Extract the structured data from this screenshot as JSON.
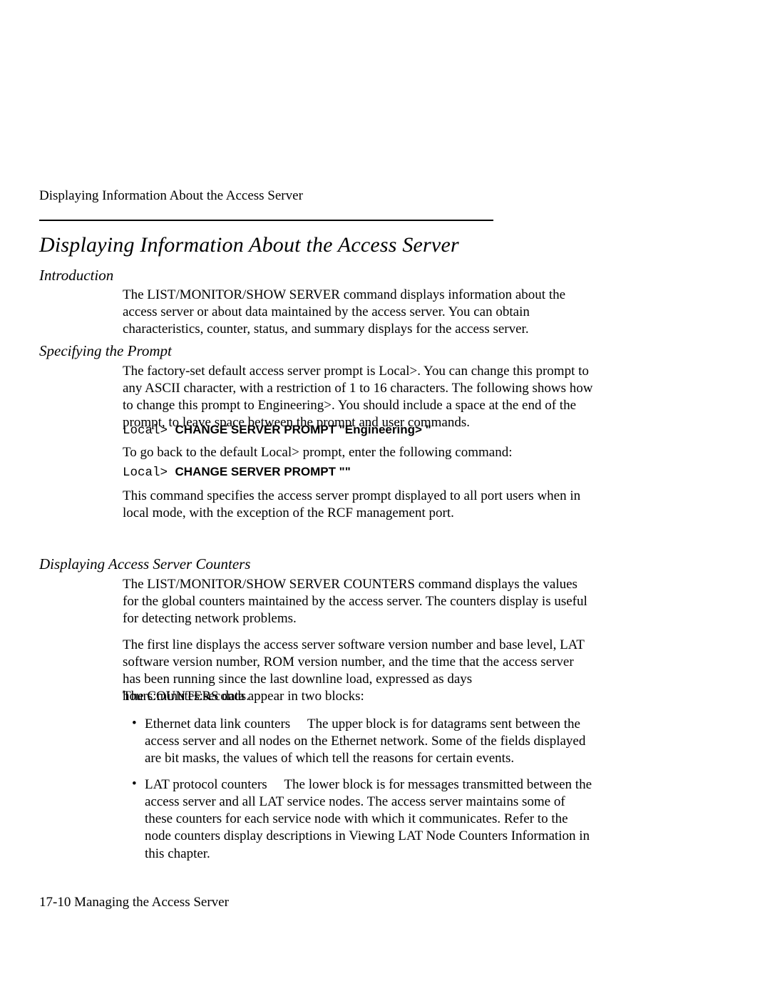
{
  "running_head": "Displaying Information About the Access Server",
  "section_title": "Displaying Information About the Access Server",
  "sections": {
    "intro": {
      "heading": "Introduction",
      "p1": "The LIST/MONITOR/SHOW SERVER command displays information about the access server or about data maintained by the access server. You can obtain characteristics, counter, status, and summary displays for the access server."
    },
    "specifying": {
      "heading": "Specifying the Prompt",
      "p1": "The factory-set default access server prompt is Local>. You can change this prompt to any ASCII character, with a restriction of 1 to 16 characters. The following shows how to change this prompt to Engineering>. You should include a space at the end of the prompt, to leave space between the prompt and user commands.",
      "code1_prefix": "Local> ",
      "code1_cmd": "CHANGE SERVER PROMPT \"Engineering> \"",
      "p2": "To go back to the default Local> prompt, enter the following command:",
      "code2_prefix": "Local> ",
      "code2_cmd": "CHANGE SERVER PROMPT \"\"",
      "p3": "This command specifies the access server prompt displayed to all port users when in local mode, with the exception of the RCF management port."
    },
    "counters": {
      "heading": "Displaying Access Server Counters",
      "p1": "The LIST/MONITOR/SHOW SERVER COUNTERS command displays the values for the global counters maintained by the access server. The counters display is useful for detecting network problems.",
      "p2": "The first line displays the access server software version number and base level, LAT software version number, ROM version number, and the time that the access server has been running since the last downline load, expressed as days hours:minutes:seconds.",
      "p3": "The COUNTERS data appear in two blocks:",
      "bullets": [
        "Ethernet data link counters  The upper block is for datagrams sent between the access server and all nodes on the Ethernet network. Some of the fields displayed are bit masks, the values of which tell the reasons for certain events.",
        "LAT protocol counters  The lower block is for messages transmitted between the access server and all LAT service nodes. The access server maintains some of these counters for each service node with which it communicates. Refer to the node counters display descriptions in Viewing LAT Node Counters Information in this chapter."
      ]
    }
  },
  "footer": "17-10  Managing the Access Server"
}
